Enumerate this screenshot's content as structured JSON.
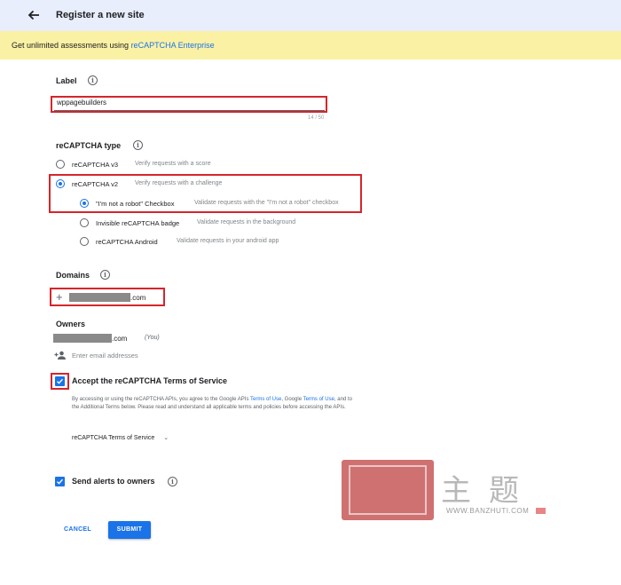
{
  "header": {
    "title": "Register a new site",
    "back_icon": "arrow-back-icon"
  },
  "banner": {
    "prefix": "Get unlimited assessments using ",
    "link": "reCAPTCHA Enterprise"
  },
  "label_section": {
    "label": "Label",
    "value": "wppagebuilders",
    "counter": "14 / 50"
  },
  "type_section": {
    "label": "reCAPTCHA type",
    "options": [
      {
        "name": "reCAPTCHA v3",
        "desc": "Verify requests with a score",
        "selected": false
      },
      {
        "name": "reCAPTCHA v2",
        "desc": "Verify requests with a challenge",
        "selected": true
      }
    ],
    "suboptions": [
      {
        "name": "\"I'm not a robot\" Checkbox",
        "desc": "Validate requests with the \"I'm not a robot\" checkbox",
        "selected": true
      },
      {
        "name": "Invisible reCAPTCHA badge",
        "desc": "Validate requests in the background",
        "selected": false
      },
      {
        "name": "reCAPTCHA Android",
        "desc": "Validate requests in your android app",
        "selected": false
      }
    ]
  },
  "domains": {
    "label": "Domains",
    "add_symbol": "+",
    "value_suffix": ".com"
  },
  "owners": {
    "label": "Owners",
    "value_suffix": ".com",
    "you": "(You)",
    "placeholder": "Enter email addresses"
  },
  "terms": {
    "label": "Accept the reCAPTCHA Terms of Service",
    "checked": true,
    "text_1": "By accessing or using the reCAPTCHA APIs, you agree to the Google APIs ",
    "link_1": "Terms of Use",
    "text_2": ", Google ",
    "link_2": "Terms of Use",
    "text_3": ", and to the Additional Terms below. Please read and understand all applicable terms and policies before accessing the APIs.",
    "select_label": "reCAPTCHA Terms of Service",
    "select_chevron": "⌄"
  },
  "alerts": {
    "label": "Send alerts to owners",
    "checked": true
  },
  "actions": {
    "cancel": "CANCEL",
    "submit": "SUBMIT"
  },
  "watermark": {
    "chars": "主题",
    "url": "WWW.BANZHUTI.COM"
  },
  "colors": {
    "accent": "#1a73e8",
    "banner": "#fbf1a4",
    "header": "#e8eefb",
    "highlight": "#d6252b"
  }
}
